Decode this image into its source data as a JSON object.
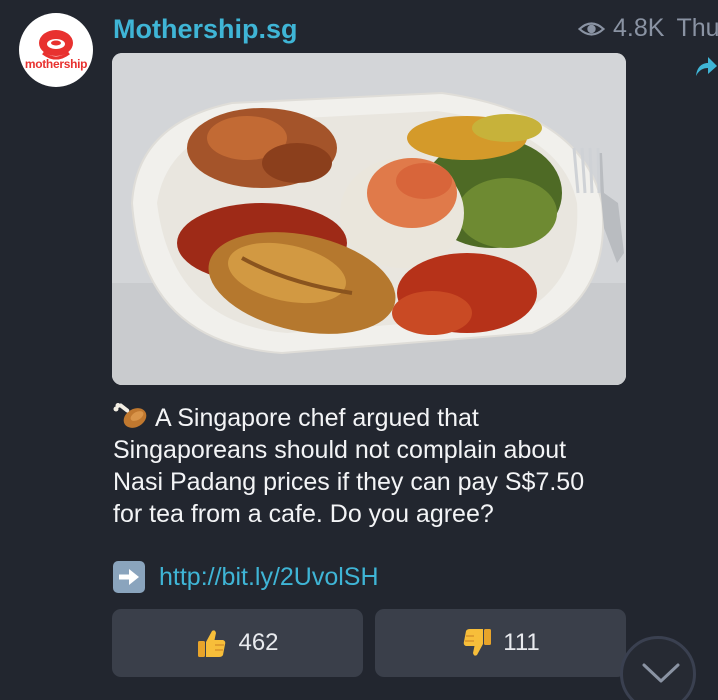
{
  "channel": {
    "name": "Mothership.sg",
    "avatar_label": "mothership",
    "views": "4.8K",
    "date": "Thu"
  },
  "post": {
    "image_icon": "food-photo",
    "emoji_icon": "poultry-leg-icon",
    "text_lines": [
      "A Singapore chef argued that",
      "Singaporeans should not complain about",
      "Nasi Padang prices if they can pay S$7.50",
      "for tea from a cafe. Do you agree?"
    ],
    "link_icon": "right-arrow-icon",
    "link": "http://bit.ly/2UvolSH"
  },
  "reactions": {
    "like_icon": "thumbs-up-icon",
    "like_count": "462",
    "dislike_icon": "thumbs-down-icon",
    "dislike_count": "111"
  },
  "colors": {
    "background": "#22262f",
    "accent": "#3fb5d6",
    "button": "#3a3f4a",
    "brand_red": "#e8312f"
  }
}
